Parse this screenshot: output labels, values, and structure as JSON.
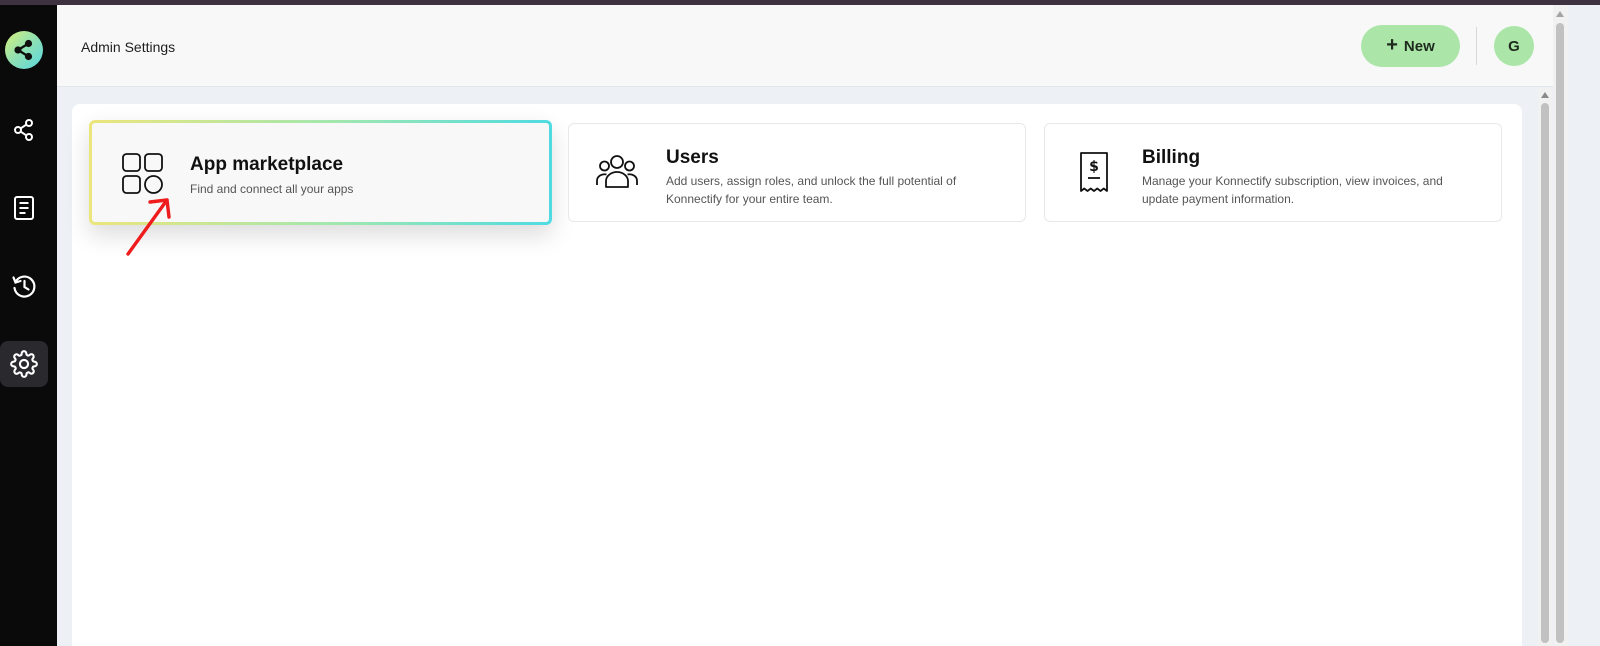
{
  "header": {
    "title": "Admin Settings",
    "new_button_label": "New",
    "avatar_initial": "G"
  },
  "sidebar": {
    "items": [
      {
        "name": "workflows",
        "icon": "share-icon"
      },
      {
        "name": "documents",
        "icon": "document-icon"
      },
      {
        "name": "history",
        "icon": "history-icon"
      },
      {
        "name": "settings",
        "icon": "gear-icon",
        "active": true
      }
    ]
  },
  "cards": [
    {
      "title": "App marketplace",
      "description": "Find and connect all your apps",
      "icon": "apps-grid-icon",
      "highlighted": true
    },
    {
      "title": "Users",
      "description": "Add users, assign roles, and unlock the full potential of Konnectify for your entire team.",
      "icon": "users-icon"
    },
    {
      "title": "Billing",
      "description": "Manage your Konnectify subscription, view invoices, and update payment information.",
      "icon": "receipt-icon"
    }
  ],
  "colors": {
    "accent_green": "#abe5a8",
    "sidebar_bg": "#0a0a0b",
    "annotation_red": "#ee1c1c"
  }
}
